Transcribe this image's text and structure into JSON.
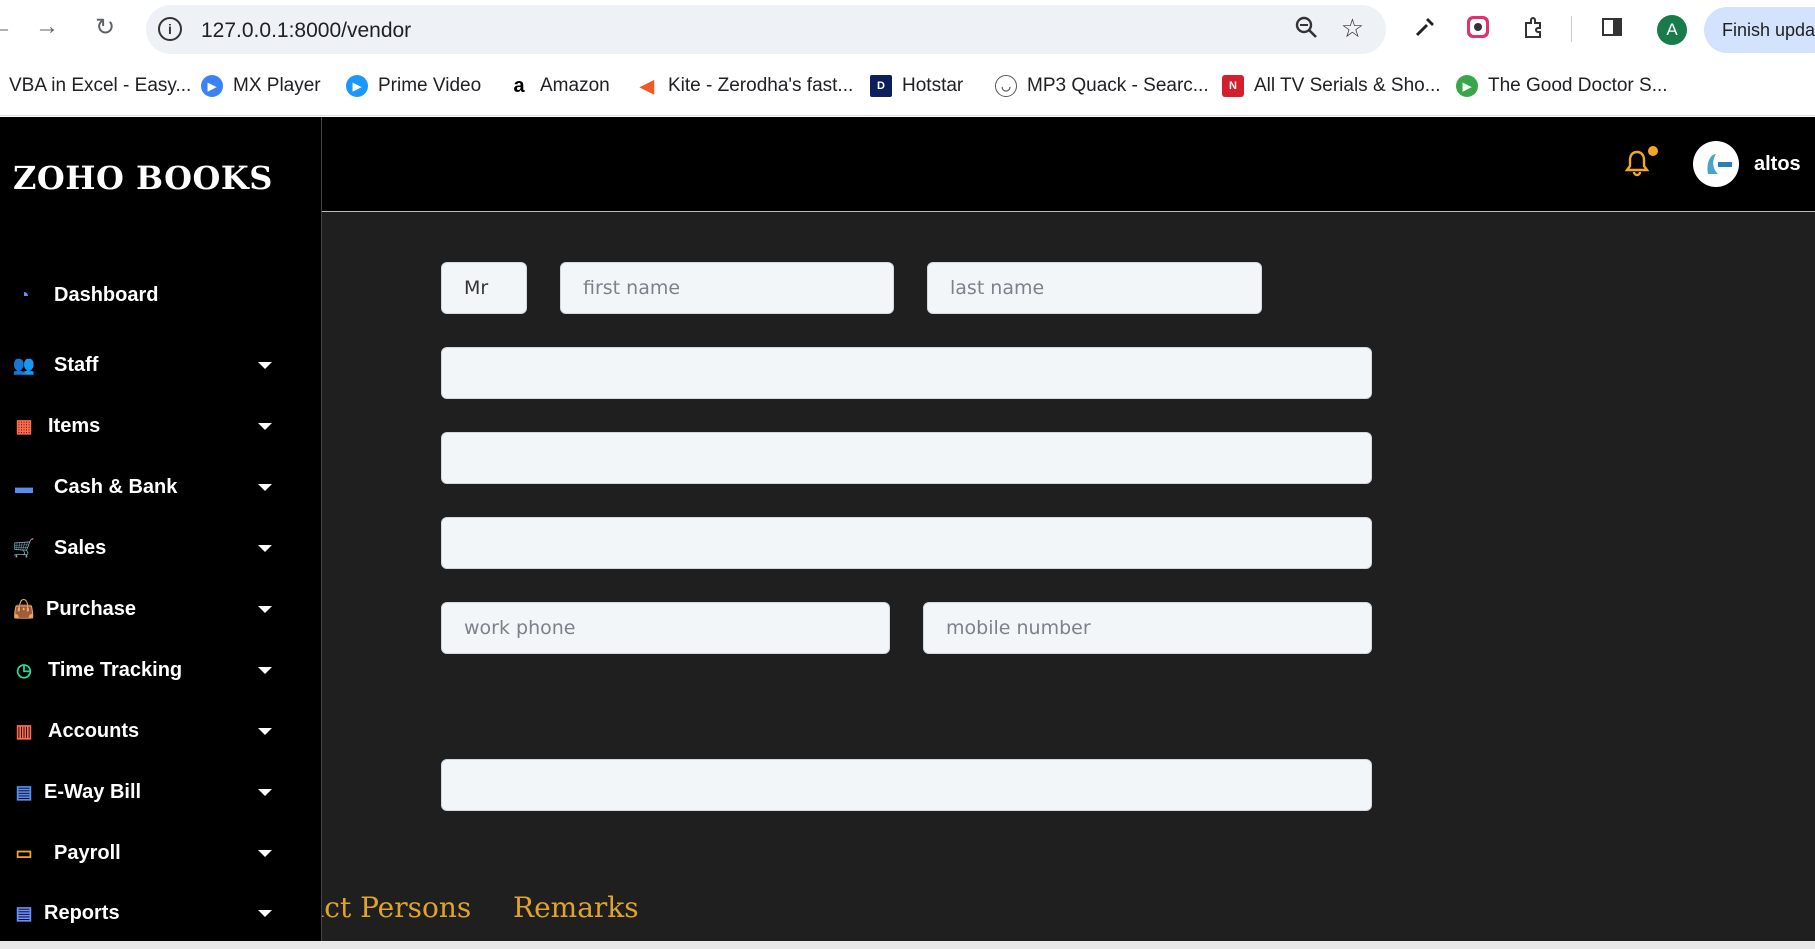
{
  "browser": {
    "url": "127.0.0.1:8000/vendor",
    "update_label": "Finish update",
    "profile_initial": "A"
  },
  "bookmarks": [
    {
      "label": "VBA in Excel - Easy...",
      "color": "#1d6f42"
    },
    {
      "label": "MX Player",
      "color": "#3b82f6"
    },
    {
      "label": "Prime Video",
      "color": "#1a98ff"
    },
    {
      "label": "Amazon",
      "color": "#000000"
    },
    {
      "label": "Kite - Zerodha's fast...",
      "color": "#f05a28"
    },
    {
      "label": "Hotstar",
      "color": "#0c1e5b"
    },
    {
      "label": "MP3 Quack - Searc...",
      "color": "#f5c518"
    },
    {
      "label": "All TV Serials & Sho...",
      "color": "#d61f2c"
    },
    {
      "label": "The Good Doctor S...",
      "color": "#3aa64a"
    }
  ],
  "sidebar": {
    "brand": "ZOHO BOOKS",
    "items": [
      {
        "label": "Dashboard",
        "icon": "dashboard-icon",
        "color": "#6c8cff"
      },
      {
        "label": "Staff",
        "icon": "users-icon",
        "color": "#2fd6a0"
      },
      {
        "label": "Items",
        "icon": "grid-icon",
        "color": "#ff6b4a"
      },
      {
        "label": "Cash & Bank",
        "icon": "money-icon",
        "color": "#5b8def"
      },
      {
        "label": "Sales",
        "icon": "cart-icon",
        "color": "#f5a623"
      },
      {
        "label": "Purchase",
        "icon": "bag-icon",
        "color": "#6c8cff"
      },
      {
        "label": "Time Tracking",
        "icon": "clock-icon",
        "color": "#2fd6a0"
      },
      {
        "label": "Accounts",
        "icon": "bar-chart-icon",
        "color": "#ff6b4a"
      },
      {
        "label": "E-Way Bill",
        "icon": "file-icon",
        "color": "#5b8def"
      },
      {
        "label": "Payroll",
        "icon": "card-icon",
        "color": "#f5a623"
      },
      {
        "label": "Reports",
        "icon": "report-icon",
        "color": "#6c8cff"
      }
    ]
  },
  "topbar": {
    "user_name": "altos"
  },
  "form": {
    "salutation": "Mr",
    "first_name_placeholder": "first name",
    "last_name_placeholder": "last name",
    "work_phone_placeholder": "work phone",
    "mobile_placeholder": "mobile number"
  },
  "tabs": {
    "contact_persons": "Contact Persons",
    "remarks": "Remarks"
  }
}
